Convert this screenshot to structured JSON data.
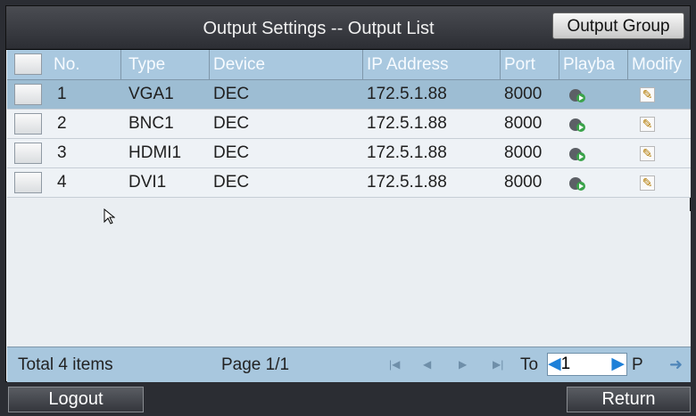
{
  "window": {
    "title": "Output Settings -- Output List",
    "group_button": "Output Group"
  },
  "table": {
    "headers": [
      "No.",
      "Type",
      "Device",
      "IP Address",
      "Port",
      "Playba",
      "Modify"
    ],
    "rows": [
      {
        "no": "1",
        "type": "VGA1",
        "device": "DEC",
        "ip": "172.5.1.88",
        "port": "8000"
      },
      {
        "no": "2",
        "type": "BNC1",
        "device": "DEC",
        "ip": "172.5.1.88",
        "port": "8000"
      },
      {
        "no": "3",
        "type": "HDMI1",
        "device": "DEC",
        "ip": "172.5.1.88",
        "port": "8000"
      },
      {
        "no": "4",
        "type": "DVI1",
        "device": "DEC",
        "ip": "172.5.1.88",
        "port": "8000"
      }
    ]
  },
  "footer": {
    "total": "Total 4 items",
    "page": "Page 1/1",
    "to_label": "To",
    "page_input": "1",
    "p_label": "P"
  },
  "buttons": {
    "logout": "Logout",
    "return": "Return"
  },
  "icons": {
    "playback": "playback-icon",
    "modify": "edit-icon",
    "first": "first-page-icon",
    "prev": "previous-page-icon",
    "next": "next-page-icon",
    "last": "last-page-icon",
    "go": "go-arrow-icon"
  },
  "colors": {
    "header": "#a9c8df",
    "selected": "#9dbdd3",
    "title_bar": "#2c2e34"
  }
}
